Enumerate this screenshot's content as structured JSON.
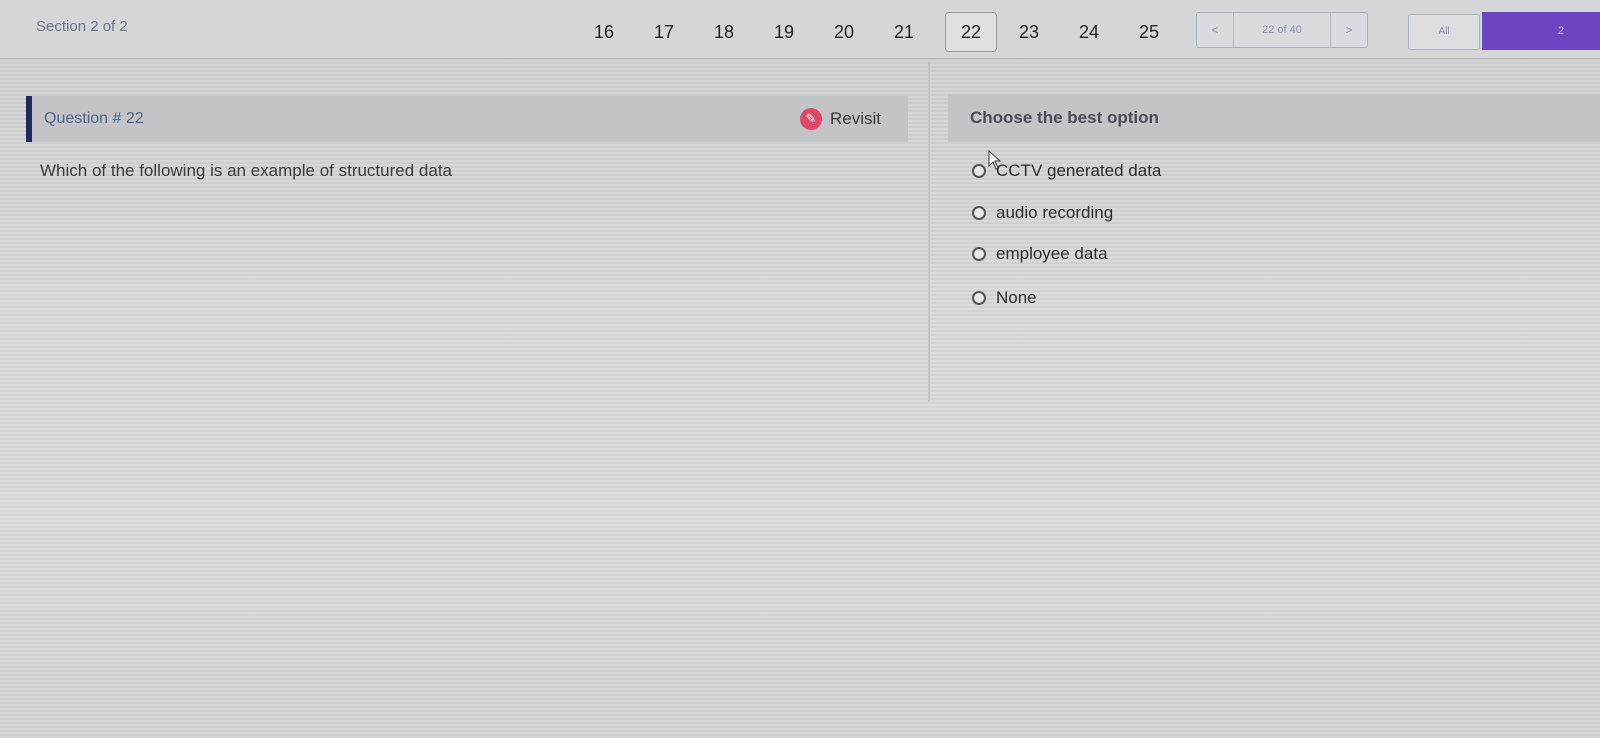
{
  "header": {
    "section_label": "Section 2 of 2",
    "page_numbers": [
      "16",
      "17",
      "18",
      "19",
      "20",
      "21",
      "22",
      "23",
      "24",
      "25"
    ],
    "active_page": "22",
    "pager": {
      "prev": "<",
      "count": "22 of 40",
      "next": ">"
    },
    "all_label": "All",
    "right_label": "2"
  },
  "question": {
    "title": "Question # 22",
    "revisit_label": "Revisit",
    "text": "Which of the following is an example of structured data"
  },
  "options": {
    "title": "Choose the best option",
    "items": [
      "CCTV generated data",
      "audio recording",
      "employee data",
      "None"
    ]
  },
  "colors": {
    "accent": "#1f2c5a",
    "purple": "#6b45c2",
    "revisit_icon": "#e0486a"
  },
  "icons": {
    "revisit": "edit-icon",
    "cursor": "mouse-pointer-icon"
  }
}
